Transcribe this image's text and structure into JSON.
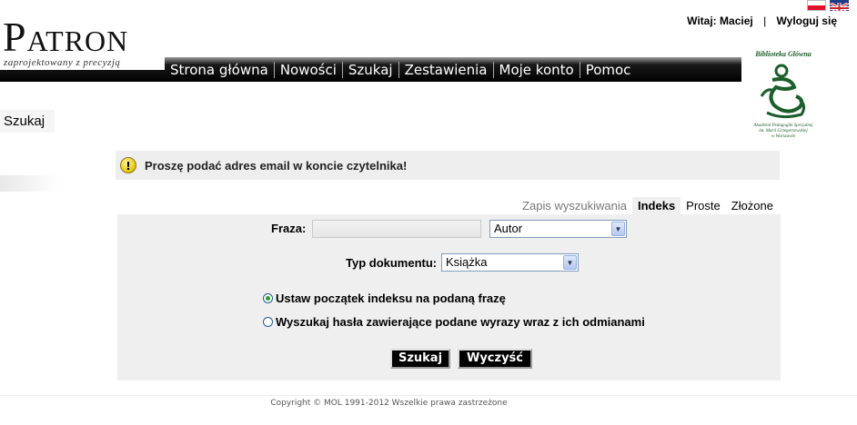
{
  "header": {
    "welcome_prefix": "Witaj:",
    "user_name": "Maciej",
    "separator": "|",
    "logout": "Wyloguj się",
    "flags": [
      "flag-pl-icon",
      "flag-gb-icon"
    ]
  },
  "brand": {
    "logo": "Patron",
    "tagline": "zaprojektowany z precyzją"
  },
  "nav": {
    "items": [
      "Strona główna",
      "Nowości",
      "Szukaj",
      "Zestawienia",
      "Moje konto",
      "Pomoc"
    ]
  },
  "library": {
    "title": "Biblioteka Główna",
    "sub1": "Akademii Pedagogiki Specjalnej",
    "sub2": "im. Marii Grzegorzewskiej",
    "sub3": "w Warszawie"
  },
  "sidebar": {
    "title": "Szukaj"
  },
  "message": {
    "text": "Proszę podać adres email w koncie czytelnika!",
    "icon": "warning-icon"
  },
  "tabs": [
    "Zapis wyszukiwania",
    "Indeks",
    "Proste",
    "Złożone"
  ],
  "form": {
    "phrase_label": "Fraza:",
    "phrase_value": "",
    "field_select": "Autor",
    "doc_type_label": "Typ dokumentu:",
    "doc_type_select": "Książka",
    "radio1": "Ustaw początek indeksu na podaną frazę",
    "radio2": "Wyszukaj hasła zawierające podane wyrazy wraz z ich odmianami",
    "search_button": "Szukaj",
    "clear_button": "Wyczyść"
  },
  "footer": {
    "copyright": "Copyright © MOL 1991-2012 Wszelkie prawa zastrzeżone"
  },
  "colors": {
    "nav_bg": "#000000",
    "accent_green": "#1c5e2a",
    "panel_bg": "#efefef"
  }
}
